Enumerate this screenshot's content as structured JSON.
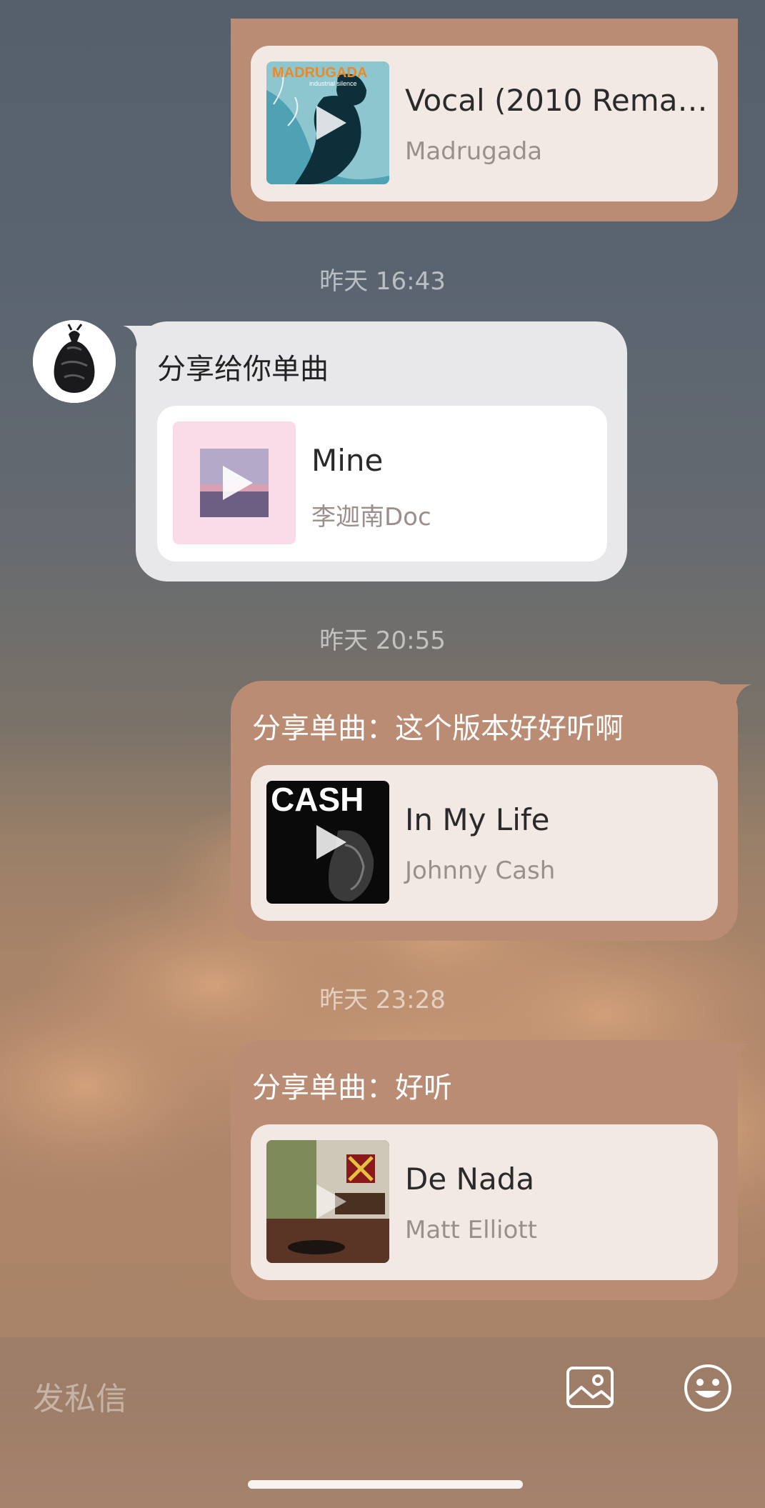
{
  "input_bar": {
    "placeholder": "发私信",
    "image_button_icon": "image-icon",
    "emoji_button_icon": "emoji-icon"
  },
  "messages": [
    {
      "direction": "sent",
      "caption": "",
      "song": {
        "title": "Vocal (2010 Remast…",
        "artist": "Madrugada",
        "cover_text": "MADRUGADA",
        "cover_subtext": "industrial silence"
      }
    },
    {
      "timestamp": "昨天 16:43",
      "direction": "received",
      "caption": "分享给你单曲",
      "song": {
        "title": "Mine",
        "artist": "李迦南Doc"
      }
    },
    {
      "timestamp": "昨天 20:55",
      "direction": "sent",
      "caption": "分享单曲：这个版本好好听啊",
      "song": {
        "title": "In My Life",
        "artist": "Johnny Cash",
        "cover_text": "CASH"
      }
    },
    {
      "timestamp": "昨天 23:28",
      "direction": "sent",
      "caption": "分享单曲：好听",
      "song": {
        "title": "De Nada",
        "artist": "Matt Elliott"
      }
    }
  ],
  "colors": {
    "sent_bubble": "#b98c73",
    "received_bubble": "#e8e7ea",
    "sent_card": "#f3e9e4",
    "received_card": "#ffffff"
  }
}
